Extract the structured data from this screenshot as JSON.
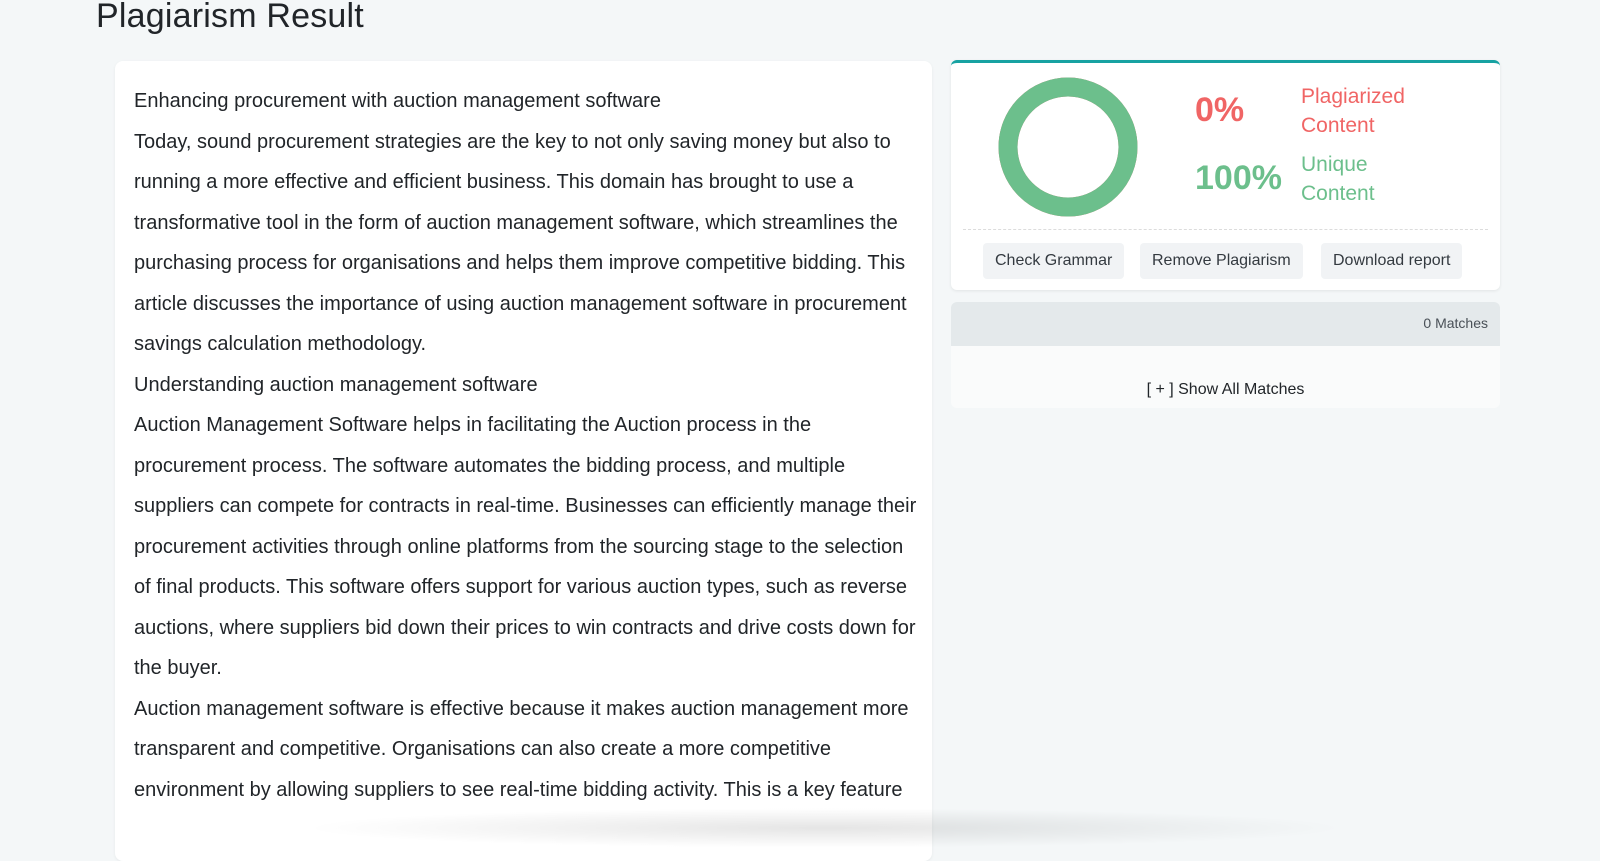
{
  "page": {
    "title": "Plagiarism Result"
  },
  "document": {
    "heading": "Enhancing procurement with auction management software",
    "intro": "Today, sound procurement strategies are the key to not only saving money but also to running a more effective and efficient business. This domain has brought to use a transformative tool in the form of auction management software, which streamlines the purchasing process for organisations and helps them improve competitive bidding. This article discusses the importance of using auction management software in procurement savings calculation methodology.",
    "section_heading": "Understanding auction management software",
    "paragraph_1": "Auction Management Software helps in facilitating the Auction process in the procurement process. The software automates the bidding process, and multiple suppliers can compete for contracts in real-time. Businesses can efficiently manage their procurement activities through online platforms from the sourcing stage to the selection of final products. This software offers support for various auction types, such as reverse auctions, where suppliers bid down their prices to win contracts and drive costs down for the buyer.",
    "paragraph_2": "Auction management software is effective because it makes auction management more transparent and competitive. Organisations can also create a more competitive environment by allowing suppliers to see real-time bidding activity. This is a key feature"
  },
  "result": {
    "plagiarized_percent": "0%",
    "plagiarized_label": "Plagiarized Content",
    "unique_percent": "100%",
    "unique_label": "Unique Content",
    "unique_fraction": 1.0,
    "colors": {
      "plagiarized": "#f06565",
      "unique": "#6cbf8c",
      "accent": "#17a2a2"
    },
    "actions": {
      "check_grammar": "Check Grammar",
      "remove_plagiarism": "Remove Plagiarism",
      "download_report": "Download report"
    }
  },
  "matches": {
    "count_label": "0 Matches",
    "show_all_label": "[ + ] Show All Matches"
  }
}
